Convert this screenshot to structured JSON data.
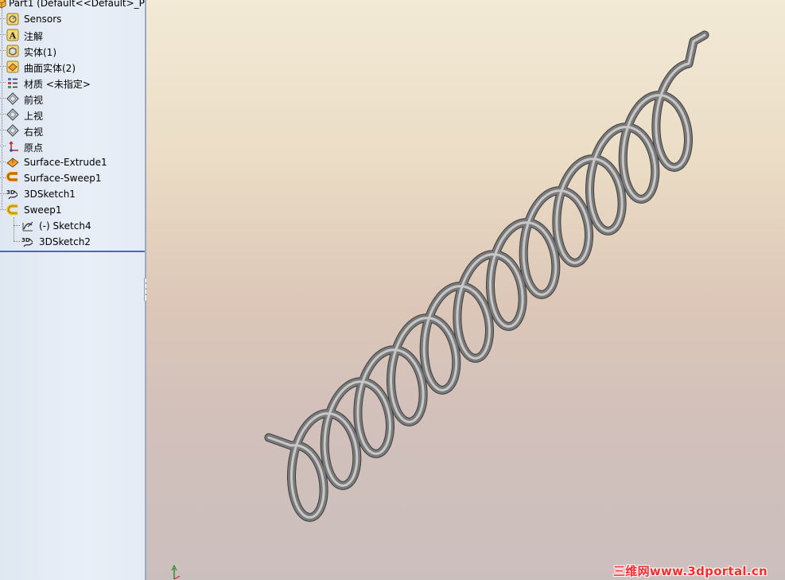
{
  "feature_tree": {
    "root_label": "Part1  (Default<<Default>_Ph",
    "items": [
      {
        "label": "Sensors",
        "icon": "sensors-icon"
      },
      {
        "label": "注解",
        "icon": "annotations-icon"
      },
      {
        "label": "实体(1)",
        "icon": "solid-bodies-icon"
      },
      {
        "label": "曲面实体(2)",
        "icon": "surface-bodies-icon"
      },
      {
        "label": "材质 <未指定>",
        "icon": "material-icon"
      },
      {
        "label": "前视",
        "icon": "plane-icon"
      },
      {
        "label": "上视",
        "icon": "plane-icon"
      },
      {
        "label": "右视",
        "icon": "plane-icon"
      },
      {
        "label": "原点",
        "icon": "origin-icon"
      },
      {
        "label": "Surface-Extrude1",
        "icon": "surface-extrude-icon"
      },
      {
        "label": "Surface-Sweep1",
        "icon": "surface-sweep-icon"
      },
      {
        "label": "3DSketch1",
        "icon": "3dsketch-icon"
      },
      {
        "label": "Sweep1",
        "icon": "sweep-icon"
      }
    ],
    "children": [
      {
        "label": "(-) Sketch4",
        "icon": "sketch-icon"
      },
      {
        "label": "3DSketch2",
        "icon": "3dsketch-icon"
      }
    ]
  },
  "viewport": {
    "model": "coil-spring-model",
    "watermark": "三维网www.3dportal.cn"
  },
  "colors": {
    "tube": "#7a7a7a",
    "tube_highlight": "#c8c8c8",
    "panel": "#e4ebf5",
    "accent": "#3a6fc4",
    "watermark": "#ff2a2a"
  }
}
